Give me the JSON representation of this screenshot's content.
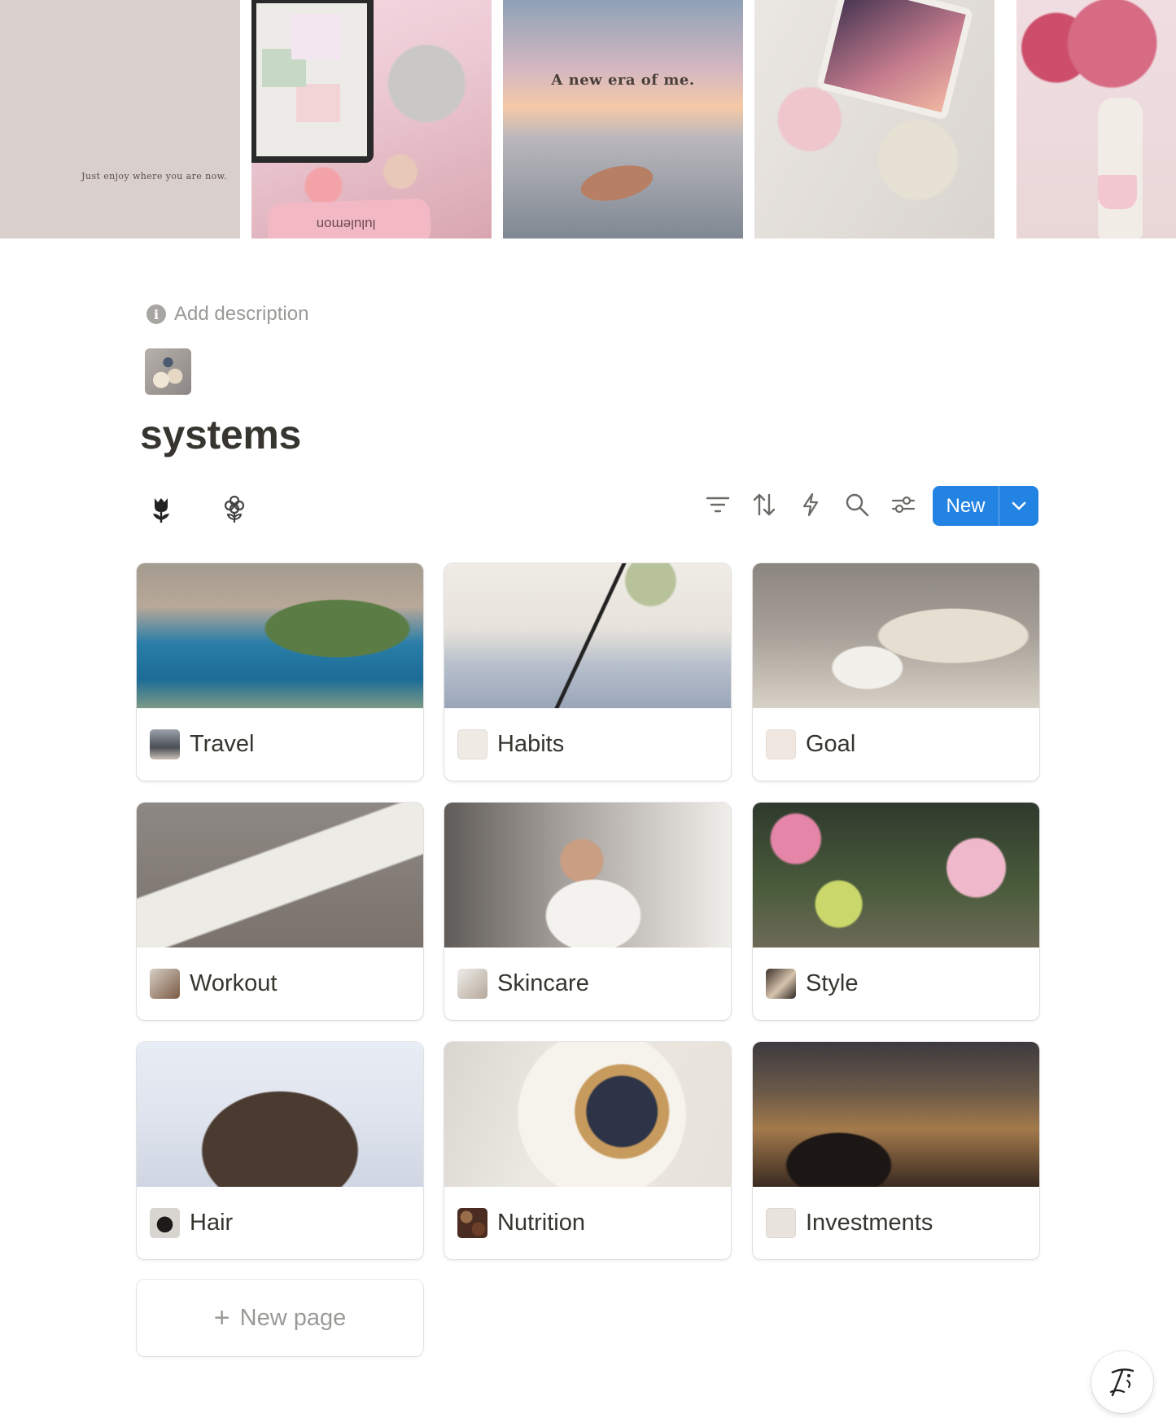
{
  "cover": {
    "tiles": [
      {
        "text": "Just enjoy where you are now."
      },
      {
        "text": "lululemon"
      },
      {
        "text": "A new era of me."
      },
      {
        "text": ""
      },
      {
        "text": ""
      }
    ]
  },
  "header": {
    "add_description": "Add description",
    "title": "systems",
    "icon": "breakfast-photo-icon"
  },
  "toolbar": {
    "view_tabs": [
      {
        "icon": "tulip-icon"
      },
      {
        "icon": "flower-outline-icon"
      }
    ],
    "tools": [
      "filter-icon",
      "sort-icon",
      "automation-bolt-icon",
      "search-icon",
      "settings-sliders-icon"
    ],
    "new_label": "New",
    "accent": "#2383e2"
  },
  "gallery": {
    "cards": [
      {
        "title": "Travel",
        "icon": "city-photo-icon"
      },
      {
        "title": "Habits",
        "icon": "small-steps-card-icon"
      },
      {
        "title": "Goal",
        "icon": "blank-card-icon"
      },
      {
        "title": "Workout",
        "icon": "fitness-photo-icon"
      },
      {
        "title": "Skincare",
        "icon": "skincare-photo-icon"
      },
      {
        "title": "Style",
        "icon": "fashion-photo-icon"
      },
      {
        "title": "Hair",
        "icon": "hair-photo-icon"
      },
      {
        "title": "Nutrition",
        "icon": "food-photo-icon"
      },
      {
        "title": "Investments",
        "icon": "beige-photo-icon"
      }
    ],
    "new_page_label": "New page"
  },
  "help": {
    "icon": "notion-ai-face-icon"
  }
}
